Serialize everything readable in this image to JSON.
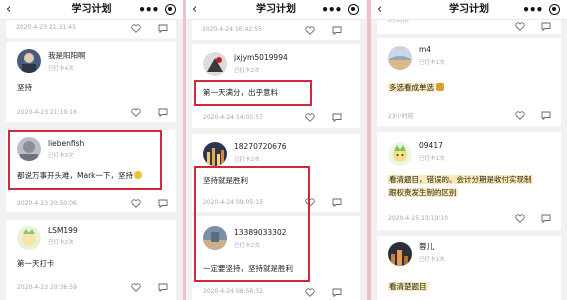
{
  "header": {
    "title": "学习计划"
  },
  "panel1": {
    "top_time": "2020-4-23 21:31:45",
    "posts": [
      {
        "username": "我是阳阳啊",
        "checkin": "已打卡4次",
        "content": "坚持",
        "time": "2020-4-23 21:19:16"
      },
      {
        "username": "liebenfish",
        "checkin": "已打卡3次",
        "content": "都说万事开头难，Mark一下，坚持",
        "time": "2020-4-23 20:50:06"
      },
      {
        "username": "LSM199",
        "checkin": "已打卡2次",
        "content": "第一天打卡",
        "time": "2020-4-23 20:36:59"
      }
    ]
  },
  "panel2": {
    "top_time": "2020-4-24 16:42:55",
    "posts": [
      {
        "username": "jxjym5019994",
        "checkin": "已打卡2次",
        "content": "第一天满分，出乎意料",
        "time": "2020-4-24 14:05:57"
      },
      {
        "username": "18270720676",
        "checkin": "已打卡2次",
        "content": "坚持就是胜利",
        "time": "2020-4-24 09:05:15"
      },
      {
        "username": "13389033302",
        "checkin": "已打卡2次",
        "content": "一定要坚持，坚持就是胜利",
        "time": "2020-4-24 08:58:32"
      }
    ]
  },
  "panel3": {
    "top_partial": "5小时前",
    "posts": [
      {
        "username": "m4",
        "checkin": "已打卡1次",
        "content": "多选看成单选",
        "time": "23小时前"
      },
      {
        "username": "09417",
        "checkin": "已打卡1次",
        "content": "看清题目，错误的。会计分期是收付实现制",
        "content_line2": "跟权责发生制的区别",
        "time": "2020-4-25 13:19:10"
      },
      {
        "username": "蓉儿",
        "checkin": "已打卡1次",
        "content": "看清楚题目"
      }
    ]
  },
  "icons": {
    "back": "chevron-left-icon",
    "more": "more-icon",
    "capsule": "target-icon",
    "like": "heart-icon",
    "comment": "comment-icon"
  },
  "colors": {
    "highlight_box": "#d0293a",
    "divider": "#ecc2c6",
    "text_highlight": "#fbeab5"
  }
}
